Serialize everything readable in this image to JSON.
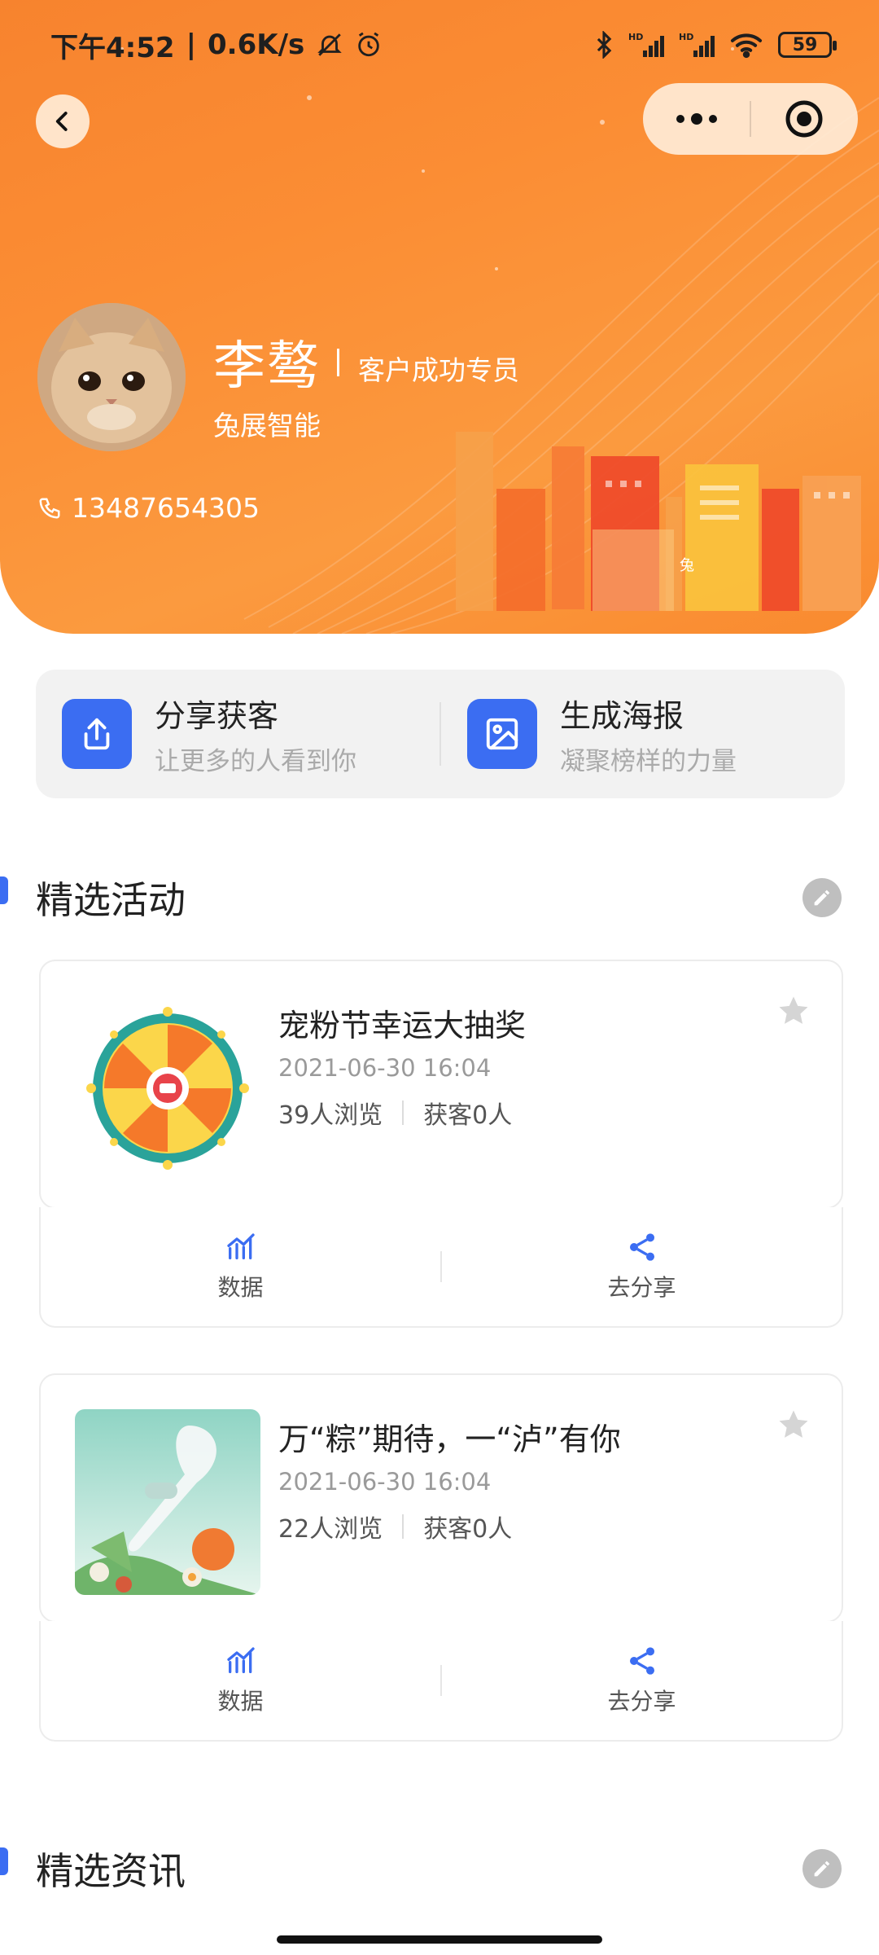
{
  "status_bar": {
    "time": "下午4:52",
    "speed": "0.6K/s",
    "battery": "59",
    "icons": [
      "mute-bell-icon",
      "alarm-icon",
      "bluetooth-icon",
      "hd-signal-icon",
      "hd-signal-icon",
      "wifi-icon",
      "battery-icon"
    ]
  },
  "nav": {
    "back_icon": "chevron-left-icon",
    "more_icon": "more-dots-icon",
    "close_icon": "target-circle-icon"
  },
  "profile": {
    "name": "李骜",
    "role": "客户成功专员",
    "company": "兔展智能",
    "phone": "13487654305"
  },
  "quick_actions": [
    {
      "title": "分享获客",
      "subtitle": "让更多的人看到你",
      "icon": "share-upload-icon"
    },
    {
      "title": "生成海报",
      "subtitle": "凝聚榜样的力量",
      "icon": "image-icon"
    }
  ],
  "sections": {
    "activities_title": "精选活动",
    "news_title": "精选资讯"
  },
  "activities": [
    {
      "title": "宠粉节幸运大抽奖",
      "date": "2021-06-30 16:04",
      "views": "39人浏览",
      "customers": "获客0人",
      "data_label": "数据",
      "share_label": "去分享"
    },
    {
      "title": "万“粽”期待，一“泸”有你",
      "date": "2021-06-30 16:04",
      "views": "22人浏览",
      "customers": "获客0人",
      "data_label": "数据",
      "share_label": "去分享"
    }
  ],
  "colors": {
    "header_orange": "#fb8d34",
    "accent_blue": "#3b6df2"
  }
}
